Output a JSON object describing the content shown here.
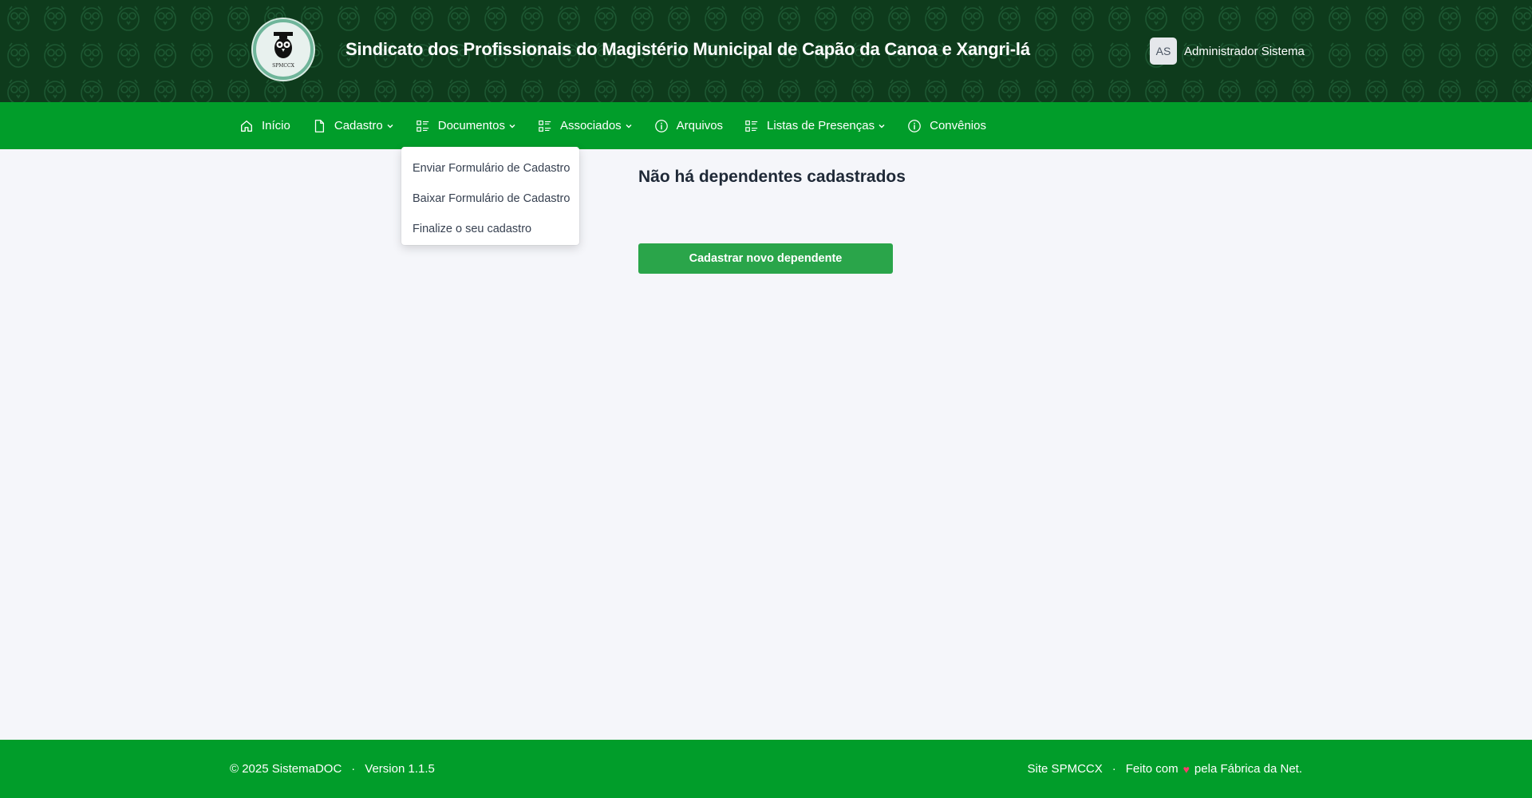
{
  "header": {
    "logo_caption": "SPMCCX",
    "title": "Sindicato dos Profissionais do Magistério Municipal de Capão da Canoa e Xangri-lá",
    "user_initials": "AS",
    "user_name": "Administrador Sistema"
  },
  "nav": {
    "items": [
      {
        "label": "Início",
        "icon": "home-icon"
      },
      {
        "label": "Cadastro",
        "icon": "document-icon",
        "dropdown": true
      },
      {
        "label": "Documentos",
        "icon": "list-icon",
        "dropdown": true
      },
      {
        "label": "Associados",
        "icon": "list-icon",
        "dropdown": true
      },
      {
        "label": "Arquivos",
        "icon": "info-icon"
      },
      {
        "label": "Listas de Presenças",
        "icon": "list-icon",
        "dropdown": true
      },
      {
        "label": "Convênios",
        "icon": "info-icon"
      }
    ]
  },
  "dropdown": {
    "items": [
      "Enviar Formulário de Cadastro",
      "Baixar Formulário de Cadastro",
      "Finalize o seu cadastro"
    ]
  },
  "main": {
    "empty_message": "Não há dependentes cadastrados",
    "new_button_label": "Cadastrar novo dependente"
  },
  "footer": {
    "copyright": "© 2025 SistemaDOC",
    "separator": "·",
    "version": "Version 1.1.5",
    "site_link": "Site SPMCCX",
    "made_with": "Feito com",
    "heart": "♥",
    "made_by": "pela Fábrica da Net."
  },
  "colors": {
    "header_bg": "#0e3b1c",
    "nav_bg": "#019d2a",
    "button_bg": "#2aa54a",
    "page_bg": "#f5f6fa"
  }
}
